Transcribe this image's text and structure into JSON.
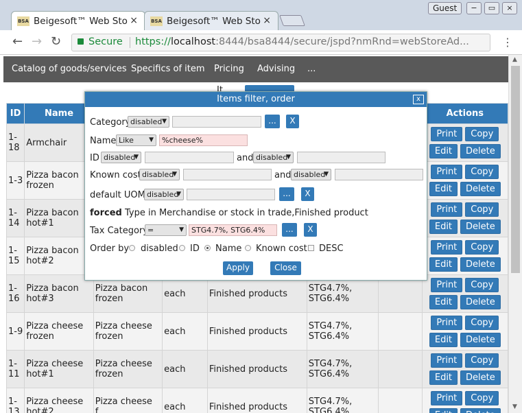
{
  "browser": {
    "tab1": "Beigesoft™ Web Sto",
    "tab2": "Beigesoft™ Web Sto",
    "favicon": "BSA",
    "close": "×",
    "guest": "Guest",
    "secure": "Secure",
    "url_scheme": "https://",
    "url_host": "localhost",
    "url_rest": ":8444/bsa8444/secure/jspd?nmRnd=webStoreAd...",
    "back": "←",
    "fwd": "→",
    "reload": "↻",
    "menu": "⋮",
    "win_min": "−",
    "win_max": "▭",
    "win_close": "×"
  },
  "nav": {
    "items": [
      "Catalog of goods/services",
      "Specifics of item",
      "Pricing",
      "Advising",
      "..."
    ]
  },
  "page": {
    "items_label": "It"
  },
  "table": {
    "headers": {
      "id": "ID",
      "name": "Name",
      "actions": "Actions"
    },
    "buttons": {
      "print": "Print",
      "copy": "Copy",
      "edit": "Edit",
      "delete": "Delete"
    },
    "rows": [
      {
        "id": "1-\n18",
        "name": "Armchair",
        "cat": "",
        "uom": "",
        "type": "",
        "tax": ""
      },
      {
        "id": "1-3",
        "name": "Pizza bacon frozen",
        "cat": "",
        "uom": "",
        "type": "",
        "tax": ""
      },
      {
        "id": "1-\n14",
        "name": "Pizza bacon hot#1",
        "cat": "",
        "uom": "",
        "type": "",
        "tax": ""
      },
      {
        "id": "1-\n15",
        "name": "Pizza bacon hot#2",
        "cat": "",
        "uom": "",
        "type": "",
        "tax": ""
      },
      {
        "id": "1-\n16",
        "name": "Pizza bacon hot#3",
        "cat": "Pizza bacon frozen",
        "uom": "each",
        "type": "Finished products",
        "tax": "STG4.7%, STG6.4%"
      },
      {
        "id": "1-9",
        "name": "Pizza cheese frozen",
        "cat": "Pizza cheese frozen",
        "uom": "each",
        "type": "Finished products",
        "tax": "STG4.7%, STG6.4%"
      },
      {
        "id": "1-\n11",
        "name": "Pizza cheese hot#1",
        "cat": "Pizza cheese frozen",
        "uom": "each",
        "type": "Finished products",
        "tax": "STG4.7%, STG6.4%"
      },
      {
        "id": "1-\n13",
        "name": "Pizza cheese hot#2",
        "cat": "Pizza cheese f...",
        "uom": "each",
        "type": "Finished products",
        "tax": "STG4.7%, STG6.4%"
      }
    ]
  },
  "dialog": {
    "title": "Items filter, order",
    "close": "x",
    "category_label": "Category",
    "category_op": "disabled",
    "dots": "...",
    "x": "X",
    "name_label": "Name",
    "name_op": "Like",
    "name_value": "%cheese%",
    "id_label": "ID",
    "id_op1": "disabled",
    "and": "and",
    "id_op2": "disabled",
    "cost_label": "Known cost",
    "cost_op1": "disabled",
    "cost_op2": "disabled",
    "uom_label": "default UOM",
    "uom_op": "disabled",
    "forced_bold": "forced",
    "forced_text": "Type in Merchandise or stock in trade,Finished product",
    "tax_label": "Tax Category",
    "tax_op": "=",
    "tax_value": "STG4.7%, STG6.4%",
    "order_label": "Order by",
    "order_opts": [
      "disabled",
      "ID",
      "Name",
      "Known cost"
    ],
    "desc": "DESC",
    "apply": "Apply",
    "close_btn": "Close"
  }
}
